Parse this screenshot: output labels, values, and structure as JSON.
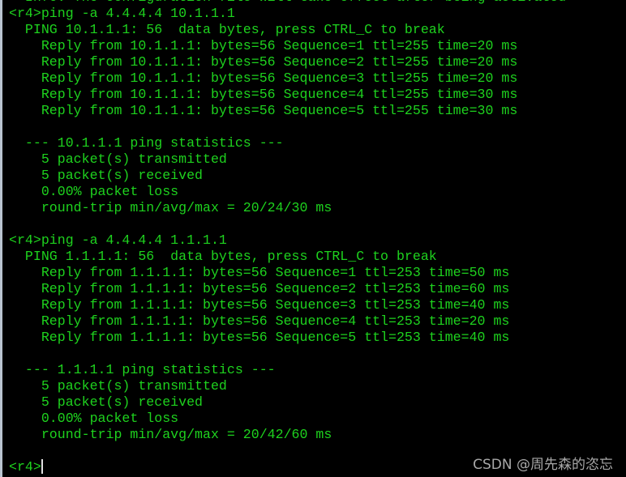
{
  "terminal": {
    "lines": [
      "  Info: The configuration file will take effect after being activated",
      "<r4>ping -a 4.4.4.4 10.1.1.1",
      "  PING 10.1.1.1: 56  data bytes, press CTRL_C to break",
      "    Reply from 10.1.1.1: bytes=56 Sequence=1 ttl=255 time=20 ms",
      "    Reply from 10.1.1.1: bytes=56 Sequence=2 ttl=255 time=20 ms",
      "    Reply from 10.1.1.1: bytes=56 Sequence=3 ttl=255 time=20 ms",
      "    Reply from 10.1.1.1: bytes=56 Sequence=4 ttl=255 time=30 ms",
      "    Reply from 10.1.1.1: bytes=56 Sequence=5 ttl=255 time=30 ms",
      "",
      "  --- 10.1.1.1 ping statistics ---",
      "    5 packet(s) transmitted",
      "    5 packet(s) received",
      "    0.00% packet loss",
      "    round-trip min/avg/max = 20/24/30 ms",
      "",
      "<r4>ping -a 4.4.4.4 1.1.1.1",
      "  PING 1.1.1.1: 56  data bytes, press CTRL_C to break",
      "    Reply from 1.1.1.1: bytes=56 Sequence=1 ttl=253 time=50 ms",
      "    Reply from 1.1.1.1: bytes=56 Sequence=2 ttl=253 time=60 ms",
      "    Reply from 1.1.1.1: bytes=56 Sequence=3 ttl=253 time=40 ms",
      "    Reply from 1.1.1.1: bytes=56 Sequence=4 ttl=253 time=20 ms",
      "    Reply from 1.1.1.1: bytes=56 Sequence=5 ttl=253 time=40 ms",
      "",
      "  --- 1.1.1.1 ping statistics ---",
      "    5 packet(s) transmitted",
      "    5 packet(s) received",
      "    0.00% packet loss",
      "    round-trip min/avg/max = 20/42/60 ms",
      ""
    ],
    "prompt": "<r4>",
    "text_color": "#1ed21e",
    "background": "#000000"
  },
  "watermark": "CSDN @周先森的恣忘"
}
